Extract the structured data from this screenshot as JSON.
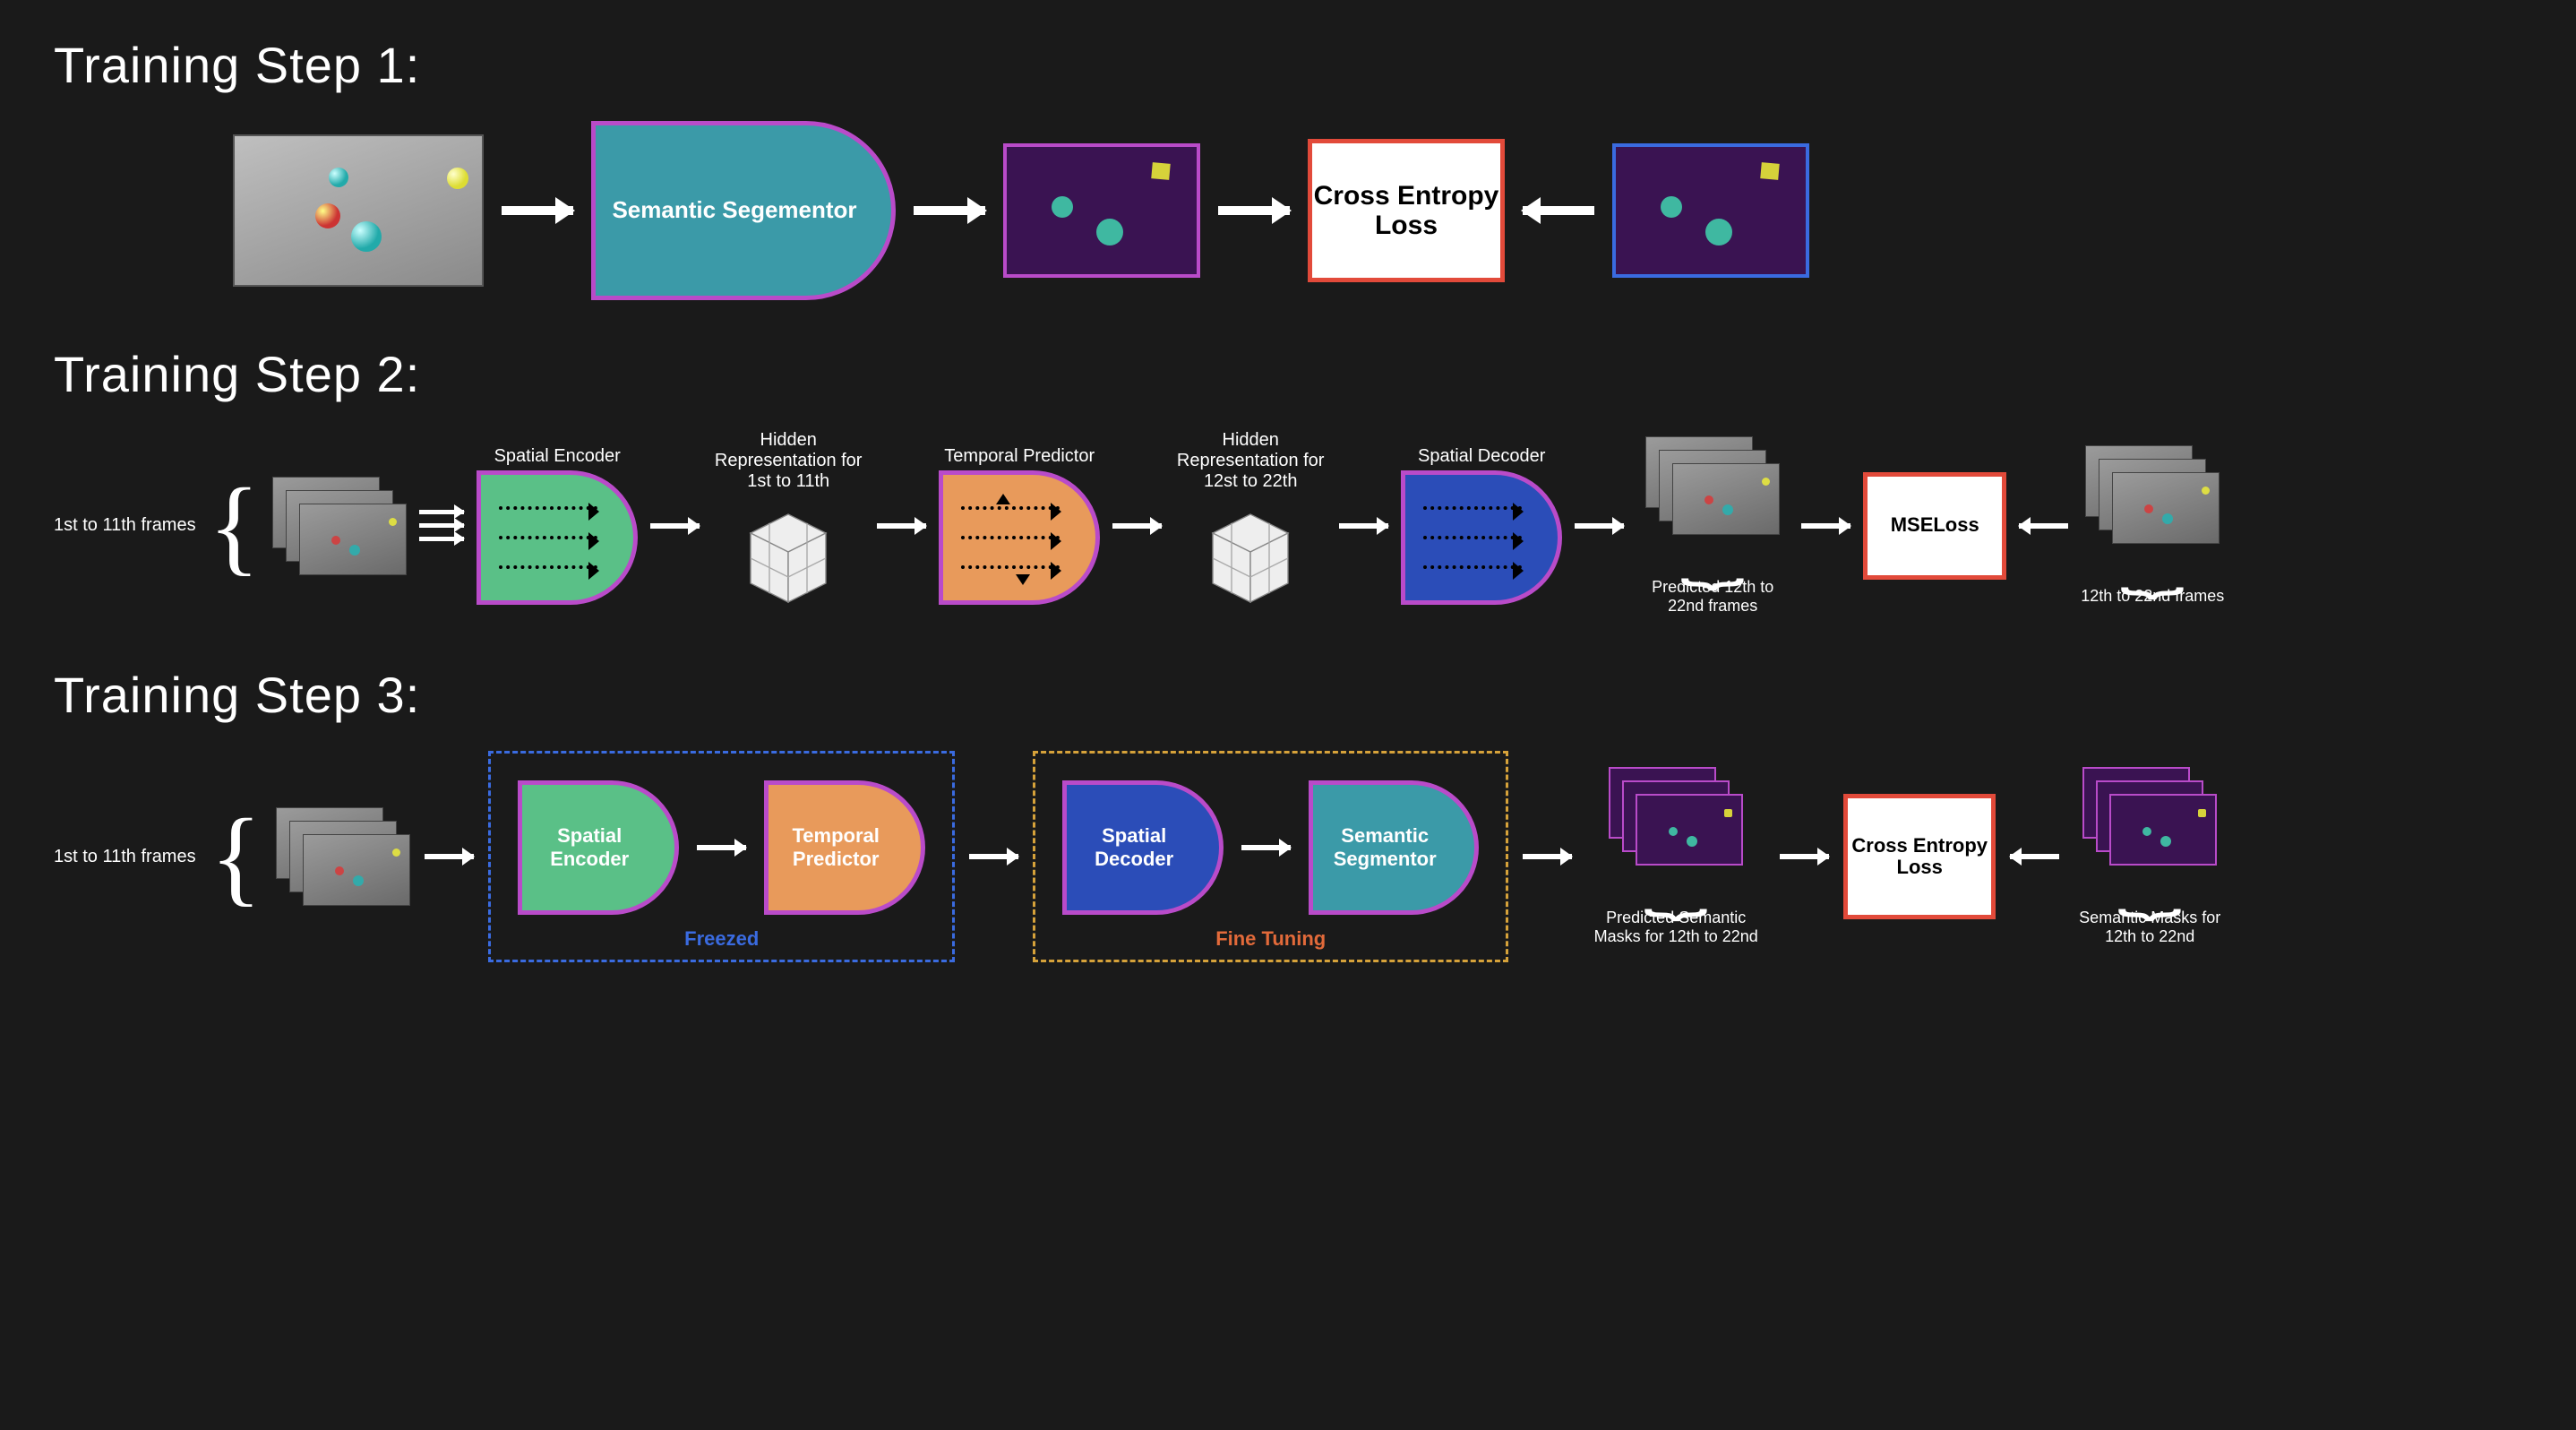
{
  "step1": {
    "title": "Training Step 1:",
    "segmentor_label": "Semantic Segementor",
    "loss_label": "Cross Entropy Loss"
  },
  "step2": {
    "title": "Training Step 2:",
    "input_frames_label": "1st to 11th frames",
    "spatial_encoder_caption": "Spatial Encoder",
    "hidden1_caption": "Hidden Representation for 1st to 11th",
    "temporal_predictor_caption": "Temporal Predictor",
    "hidden2_caption": "Hidden Representation for 12st to 22th",
    "spatial_decoder_caption": "Spatial Decoder",
    "predicted_frames_caption": "Predicted 12th to 22nd frames",
    "loss_label": "MSELoss",
    "gt_frames_caption": "12th to 22nd frames"
  },
  "step3": {
    "title": "Training Step 3:",
    "input_frames_label": "1st to 11th frames",
    "freezed_caption": "Freezed",
    "finetuning_caption": "Fine Tuning",
    "spatial_encoder_label": "Spatial Encoder",
    "temporal_predictor_label": "Temporal Predictor",
    "spatial_decoder_label": "Spatial Decoder",
    "semantic_segmentor_label": "Semantic Segmentor",
    "predicted_masks_caption": "Predicted Semantic Masks for 12th to 22nd",
    "loss_label": "Cross Entropy Loss",
    "gt_masks_caption": "Semantic Masks for 12th to 22nd"
  },
  "colors": {
    "magenta_border": "#b94bc9",
    "teal_block": "#3b9aa8",
    "green_block": "#5ac087",
    "orange_block": "#e89a5b",
    "blue_block": "#2b4db8",
    "loss_border": "#e24a3a",
    "mask_bg": "#3a1352",
    "blue_dashed": "#3a6be0",
    "orange_dashed": "#d6a23a"
  }
}
